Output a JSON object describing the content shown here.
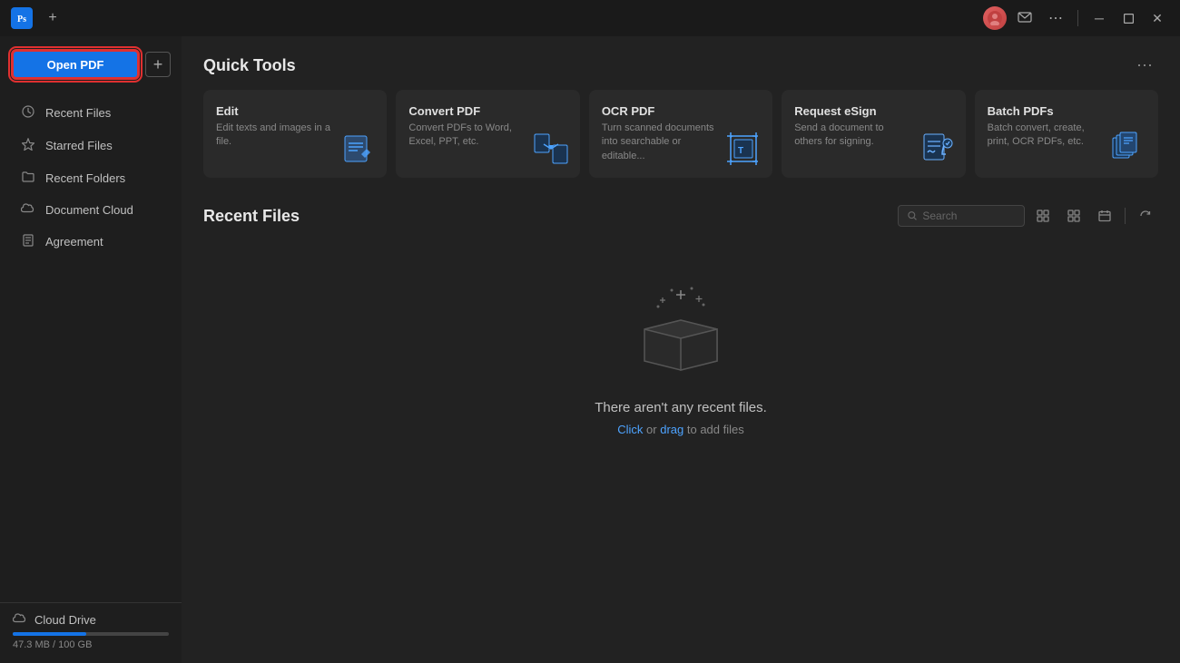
{
  "titlebar": {
    "app_icon": "Ps",
    "add_tab_label": "+",
    "more_icon": "⋯",
    "minimize": "─",
    "restore": "❐",
    "close": "✕"
  },
  "sidebar": {
    "open_pdf_label": "Open PDF",
    "add_label": "+",
    "nav_items": [
      {
        "id": "recent-files",
        "icon": "🕐",
        "label": "Recent Files"
      },
      {
        "id": "starred-files",
        "icon": "☆",
        "label": "Starred Files"
      },
      {
        "id": "recent-folders",
        "icon": "📁",
        "label": "Recent Folders"
      },
      {
        "id": "document-cloud",
        "icon": "☁",
        "label": "Document Cloud"
      },
      {
        "id": "agreement",
        "icon": "📄",
        "label": "Agreement"
      }
    ],
    "cloud_drive": {
      "label": "Cloud Drive",
      "storage_used": "47.3 MB",
      "storage_total": "100 GB",
      "storage_text": "47.3 MB / 100 GB",
      "fill_percent": 47.3
    }
  },
  "quick_tools": {
    "title": "Quick Tools",
    "more_icon": "⋯",
    "tools": [
      {
        "id": "edit",
        "title": "Edit",
        "description": "Edit texts and images in a file."
      },
      {
        "id": "convert-pdf",
        "title": "Convert PDF",
        "description": "Convert PDFs to Word, Excel, PPT, etc."
      },
      {
        "id": "ocr-pdf",
        "title": "OCR PDF",
        "description": "Turn scanned documents into searchable or editable..."
      },
      {
        "id": "request-esign",
        "title": "Request eSign",
        "description": "Send a document to others for signing."
      },
      {
        "id": "batch-pdfs",
        "title": "Batch PDFs",
        "description": "Batch convert, create, print, OCR PDFs, etc."
      }
    ]
  },
  "recent_files": {
    "title": "Recent Files",
    "search_placeholder": "Search",
    "empty_title": "There aren't any recent files.",
    "click_label": "Click",
    "or_label": " or ",
    "drag_label": "drag",
    "add_label": " to add files"
  }
}
